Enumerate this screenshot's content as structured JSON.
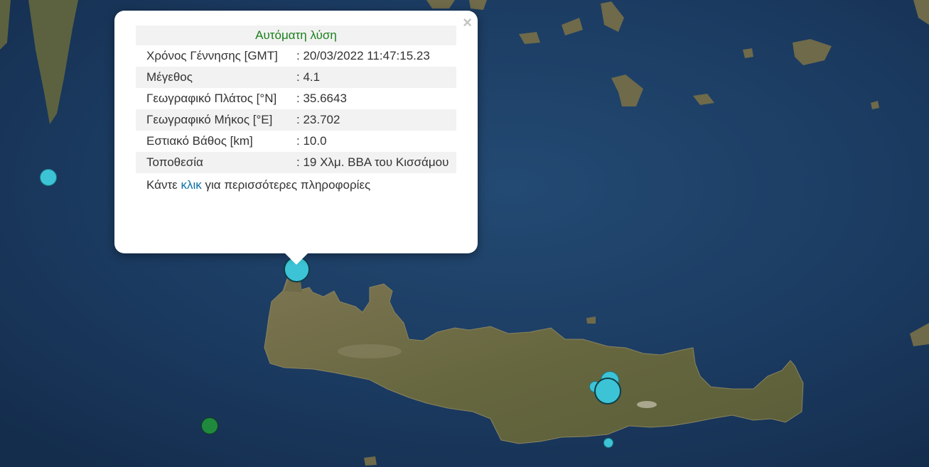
{
  "popup": {
    "title": "Αυτόματη λύση",
    "close_symbol": "×",
    "rows": [
      {
        "label": "Χρόνος Γέννησης [GMT]",
        "value": ": 20/03/2022 11:47:15.23"
      },
      {
        "label": "Μέγεθος",
        "value": ": 4.1"
      },
      {
        "label": "Γεωγραφικό Πλάτος [°N]",
        "value": ": 35.6643"
      },
      {
        "label": "Γεωγραφικό Μήκος [°E]",
        "value": ": 23.702"
      },
      {
        "label": "Εστιακό Βάθος [km]",
        "value": ": 10.0"
      },
      {
        "label": "Τοποθεσία",
        "value": ": 19 Χλμ. ΒΒΑ του Κισσάμου"
      }
    ],
    "more_prefix": "Κάντε ",
    "more_link": "κλικ",
    "more_suffix": " για περισσότερες πληροφορίες"
  },
  "colors": {
    "sea": "#1b3a5e",
    "land": "#6f6a48",
    "marker_cyan": "#3cc4d6",
    "marker_green": "#1f8a3e",
    "title_green": "#1a7f1a",
    "link_blue": "#0a6fa8"
  }
}
